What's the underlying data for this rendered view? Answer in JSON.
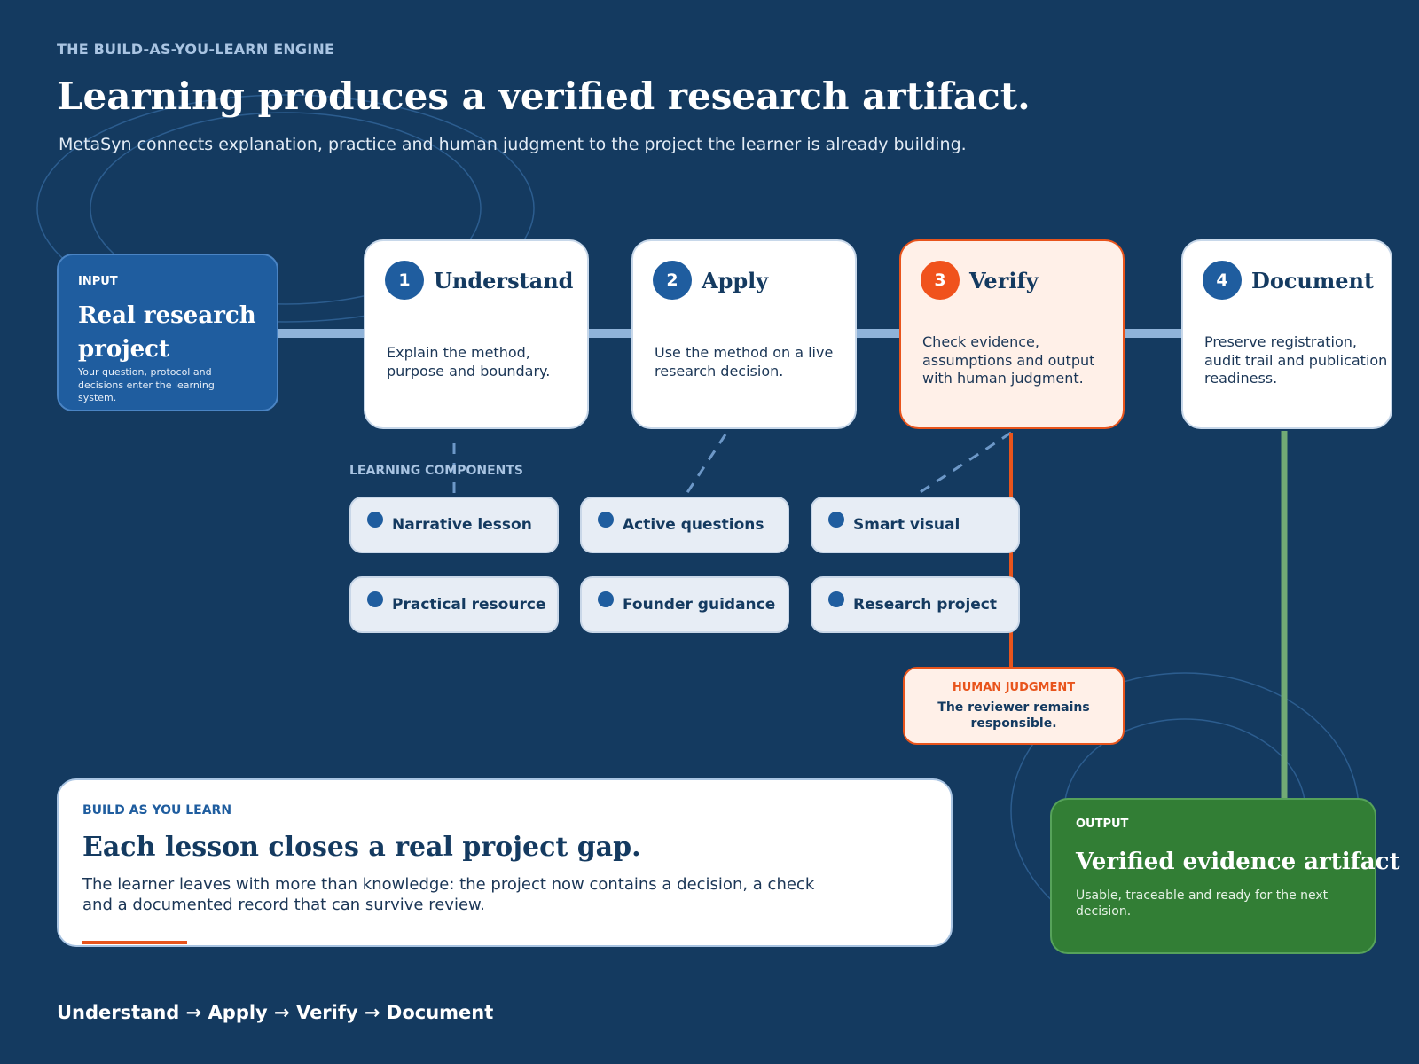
{
  "header": {
    "eyebrow": "THE BUILD-AS-YOU-LEARN ENGINE",
    "title": "Learning produces a verified research artifact.",
    "subtitle": "MetaSyn connects explanation, practice and human judgment to the project the learner is already building."
  },
  "input": {
    "label": "INPUT",
    "title": "Real research project",
    "description": "Your question, protocol and decisions enter the learning system."
  },
  "steps": [
    {
      "number": "1",
      "name": "Understand",
      "description": "Explain the method, purpose and boundary."
    },
    {
      "number": "2",
      "name": "Apply",
      "description": "Use the method on a live research decision."
    },
    {
      "number": "3",
      "name": "Verify",
      "description": "Check evidence, assumptions and output with human judgment."
    },
    {
      "number": "4",
      "name": "Document",
      "description": "Preserve registration, audit trail and publication readiness."
    }
  ],
  "learning_components": {
    "label": "LEARNING COMPONENTS",
    "items": [
      "Narrative lesson",
      "Active questions",
      "Smart visual",
      "Practical resource",
      "Founder guidance",
      "Research project"
    ]
  },
  "human_judgment": {
    "label": "HUMAN JUDGMENT",
    "text": "The reviewer remains responsible."
  },
  "build": {
    "label": "BUILD AS YOU LEARN",
    "title": "Each lesson closes a real project gap.",
    "description": "The learner leaves with more than knowledge: the project now contains a decision, a check and a documented record that can survive review."
  },
  "output": {
    "label": "OUTPUT",
    "title": "Verified evidence artifact",
    "description": "Usable, traceable and ready for the next decision."
  },
  "footer": {
    "text": "Understand → Apply → Verify → Document"
  },
  "colors": {
    "background": "#143a60",
    "accent_blue": "#1f5d9f",
    "accent_orange": "#e8541c",
    "output_green": "#327e35",
    "connector": "#8fb3d9"
  }
}
